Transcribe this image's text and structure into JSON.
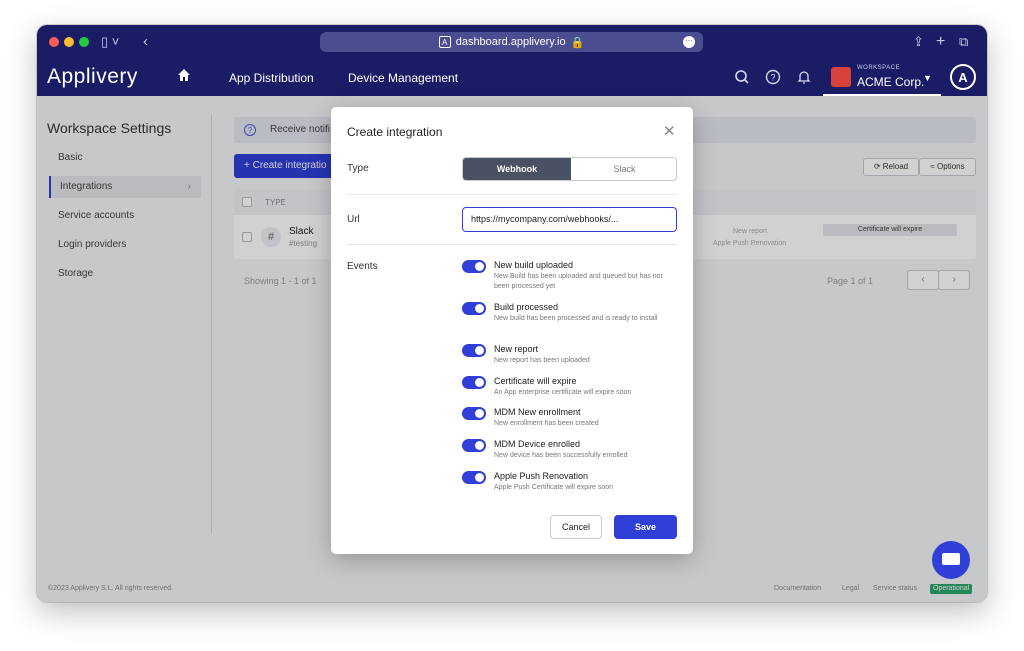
{
  "browser": {
    "url": "dashboard.applivery.io"
  },
  "app": {
    "brand": "Applivery",
    "nav": [
      "App Distribution",
      "Device Management"
    ],
    "workspace_label": "WORKSPACE",
    "workspace_name": "ACME Corp."
  },
  "sidebar": {
    "title": "Workspace Settings",
    "items": [
      {
        "label": "Basic"
      },
      {
        "label": "Integrations"
      },
      {
        "label": "Service accounts"
      },
      {
        "label": "Login providers"
      },
      {
        "label": "Storage"
      }
    ]
  },
  "main": {
    "notice": "Receive notifi",
    "create_button": "Create integratio",
    "reload": "Reload",
    "options": "Options",
    "table": {
      "header_type": "TYPE",
      "row_name": "Slack",
      "row_sub": "#testing",
      "row_event1": "New report",
      "row_event2": "Apple Push Renovation",
      "row_pill": "Certificate will expire"
    },
    "showing": "Showing 1 - 1 of 1",
    "page": "Page 1 of 1"
  },
  "footer": {
    "copyright": "©2023 Applivery S.L. All rights reserved.",
    "links": [
      "Documentation",
      "Legal",
      "Service status"
    ],
    "status": "Operational"
  },
  "modal": {
    "title": "Create integration",
    "type_label": "Type",
    "type_options": [
      "Webhook",
      "Slack"
    ],
    "url_label": "Url",
    "url_value": "https://mycompany.com/webhooks/...",
    "events_label": "Events",
    "events": [
      {
        "title": "New build uploaded",
        "desc": "New Build has been uploaded and queued but has not been processed yet",
        "enabled": true
      },
      {
        "title": "Build processed",
        "desc": "New build has been processed and is ready to install",
        "enabled": true
      },
      {
        "title": "New report",
        "desc": "New report has been uploaded",
        "enabled": true
      },
      {
        "title": "Certificate will expire",
        "desc": "An App enterprise certificate will expire soon",
        "enabled": true
      },
      {
        "title": "MDM New enrollment",
        "desc": "New enrollment has been created",
        "enabled": true
      },
      {
        "title": "MDM Device enrolled",
        "desc": "New device has been successfully enrolled",
        "enabled": true
      },
      {
        "title": "Apple Push Renovation",
        "desc": "Apple Push Certificate will expire soon",
        "enabled": true
      }
    ],
    "cancel": "Cancel",
    "save": "Save"
  }
}
